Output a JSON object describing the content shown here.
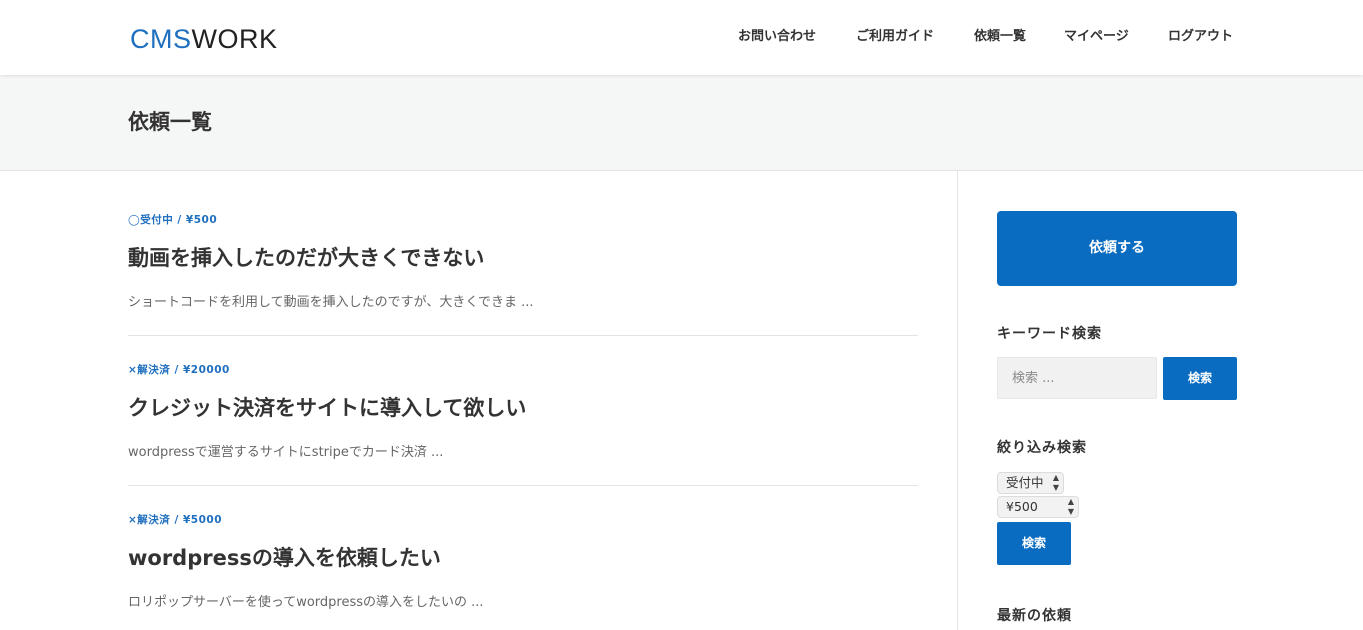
{
  "header": {
    "logo_cms": "CMS",
    "logo_work": "WORK",
    "nav": [
      {
        "label": "お問い合わせ"
      },
      {
        "label": "ご利用ガイド"
      },
      {
        "label": "依頼一覧"
      },
      {
        "label": "マイページ"
      },
      {
        "label": "ログアウト"
      }
    ]
  },
  "page": {
    "title": "依頼一覧"
  },
  "requests": [
    {
      "status": "◯受付中",
      "separator": "/",
      "price": "¥500",
      "title": "動画を挿入したのだが大きくできない",
      "excerpt": "ショートコードを利用して動画を挿入したのですが、大きくできま ..."
    },
    {
      "status": "×解決済",
      "separator": "/",
      "price": "¥20000",
      "title": "クレジット決済をサイトに導入して欲しい",
      "excerpt": "wordpressで運営するサイトにstripeでカード決済 ..."
    },
    {
      "status": "×解決済",
      "separator": "/",
      "price": "¥5000",
      "title": "wordpressの導入を依頼したい",
      "excerpt": "ロリポップサーバーを使ってwordpressの導入をしたいの ..."
    }
  ],
  "sidebar": {
    "request_button": "依頼する",
    "keyword_search": {
      "title": "キーワード検索",
      "placeholder": "検索 ...",
      "button": "検索"
    },
    "filter_search": {
      "title": "絞り込み検索",
      "status_selected": "受付中",
      "price_selected": "¥500",
      "button": "検索"
    },
    "latest_title": "最新の依頼"
  },
  "colors": {
    "accent": "#0a6cc0",
    "logo_blue": "#1f6fbf",
    "title_band": "#f5f6f6"
  }
}
